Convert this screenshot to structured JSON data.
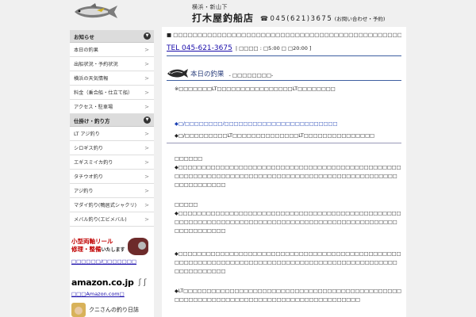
{
  "header": {
    "sub": "横浜・新山下",
    "name": "打木屋釣船店",
    "phone_icon": "☎",
    "phone": "045(621)3675",
    "phone_note": "(お問い合わせ・予約)"
  },
  "sidebar": {
    "section1": {
      "title": "お知らせ",
      "items": [
        {
          "label": "本日の釣果"
        },
        {
          "label": "出船状況・予約状況"
        },
        {
          "label": "横浜の天気情報"
        },
        {
          "label": "料金（乗合船・仕立て船）"
        },
        {
          "label": "アクセス・駐車場"
        }
      ]
    },
    "section2": {
      "title": "仕掛け・釣り方",
      "items": [
        {
          "label": "LT アジ釣り"
        },
        {
          "label": "シロギス釣り"
        },
        {
          "label": "エギスミイカ釣り"
        },
        {
          "label": "タチウオ釣り"
        },
        {
          "label": "アジ釣り"
        },
        {
          "label": "マダイ釣り(鴨居式シャクリ)"
        },
        {
          "label": "メバル釣り(エビメバル)"
        }
      ]
    },
    "arrow": ">",
    "chevron": "▼",
    "promo": {
      "line1": "小型両軸リール",
      "line2": "修理・整備",
      "line2_suffix": "いたします",
      "link": "□□□□□□/□□□□□□□"
    },
    "amazon": {
      "brand": "amazon.co.jp",
      "hooks": "ʃ ʃ",
      "link": "□□□Amazon.com□"
    },
    "kuni": {
      "title": "クニさんの釣り日誌"
    }
  },
  "main": {
    "notice": "■ □□□□□□□□□□□□□□□□□□□□□□□□□□□□□□□□□□□□□□□□□□□□□□□□□□",
    "tel": "TEL 045-621-3675",
    "hours": "| □□□□ : □5:00 □ □20:00 ]",
    "catch_title": "本日の釣果",
    "catch_sub": "- □□□□□□□□-",
    "note": "※□□□□□□□LT□□□□□□□□□□□□□□□□LT□□□□□□□□",
    "blue_line": "◆□/□□□□□□□□/□□□□□□□□□□□□□□□□□□□□□□□□",
    "dark_line": "◆□/□□□□□□□□□LT□□□□□□□□□□□□□□LT□□□□□□□□□□□□□□□",
    "block1": {
      "head": "□□□□□□",
      "text": "◆□□□□□□□□□□□□□□□□□□□□□□□□□□□□□□□□□□□□□□□□□□□□□□□□□□□□□□□□□□□□□□□□□□□□□□□□□□□□□□□□□□□□□□□□□□□□□□□□□□□□□□□□□□□"
    },
    "block2": {
      "head": "□□□□□",
      "text": "◆□□□□□□□□□□□□□□□□□□□□□□□□□□□□□□□□□□□□□□□□□□□□□□□□□□□□□□□□□□□□□□□□□□□□□□□□□□□□□□□□□□□□□□□□□□□□□□□□□□□□□□□□□□□"
    },
    "block3": {
      "text": "◆□□□□□□□□□□□□□□□□□□□□□□□□□□□□□□□□□□□□□□□□□□□□□□□□□□□□□□□□□□□□□□□□□□□□□□□□□□□□□□□□□□□□□□□□□□□□□□□□□□□□□□□□□□□"
    },
    "block4": {
      "text": "◆LT□□□□□□□□□□□□□□□□□□□□□□□□□□□□□□□□□□□□□□□□□□□□□□□□□□□□□□□□□□□□□□□□□□□□□□□□□□□□□□□□□□□□□□□"
    }
  }
}
